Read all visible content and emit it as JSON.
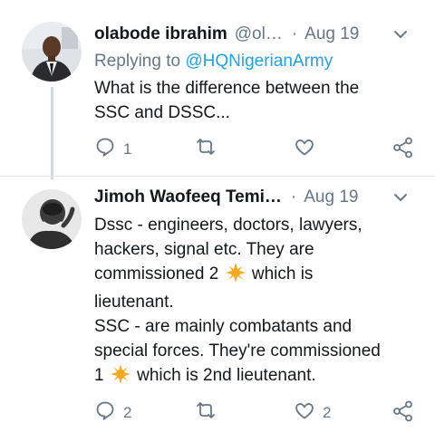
{
  "tweet1": {
    "name": "olabode ibrahim",
    "handle": "@ol…",
    "separator": "·",
    "date": "Aug 19",
    "replying_prefix": "Replying to ",
    "replying_to": "@HQNigerianArmy",
    "body_line1": "What is the difference between the",
    "body_line2": "SSC and DSSC...",
    "reply_count": "1",
    "retweet_count": "",
    "like_count": ""
  },
  "tweet2": {
    "name": "Jimoh Waofeeq Temi…",
    "separator": "·",
    "date": "Aug 19",
    "line1": "Dssc - engineers, doctors, lawyers,",
    "line2": "hackers, signal etc. They are",
    "line3a": "commissioned 2",
    "line3b": "which is",
    "line4": "lieutenant.",
    "line5": "SSC - are mainly combatants and",
    "line6": "special forces. They're commissioned",
    "line7a": "1",
    "line7b": "which is 2nd lieutenant.",
    "reply_count": "2",
    "retweet_count": "",
    "like_count": "2"
  },
  "icons": [
    "reply-icon",
    "retweet-icon",
    "like-icon",
    "share-icon",
    "chevron-down-icon",
    "sun-emoji-icon"
  ],
  "colors": {
    "muted": "#657786",
    "link": "#1da1f2",
    "text": "#14171a",
    "emoji": "#f4a81d"
  }
}
